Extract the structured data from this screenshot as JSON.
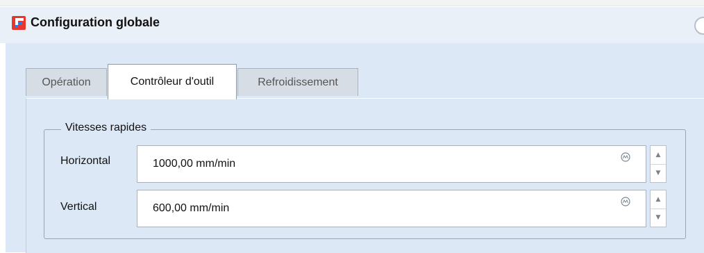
{
  "window": {
    "title": "Configuration globale"
  },
  "tabs": [
    {
      "label": "Opération",
      "active": false
    },
    {
      "label": "Contrôleur d'outil",
      "active": true
    },
    {
      "label": "Refroidissement",
      "active": false
    }
  ],
  "group": {
    "legend": "Vitesses rapides",
    "fields": [
      {
        "label": "Horizontal",
        "value": "1000,00 mm/min",
        "icon": "formula-icon"
      },
      {
        "label": "Vertical",
        "value": "600,00 mm/min",
        "icon": "formula-icon"
      }
    ]
  },
  "colors": {
    "header_bg": "#e9f0f8",
    "panel_bg": "#dce8f5",
    "app_icon_red": "#e8352e",
    "app_icon_blue": "#2a7de1"
  }
}
